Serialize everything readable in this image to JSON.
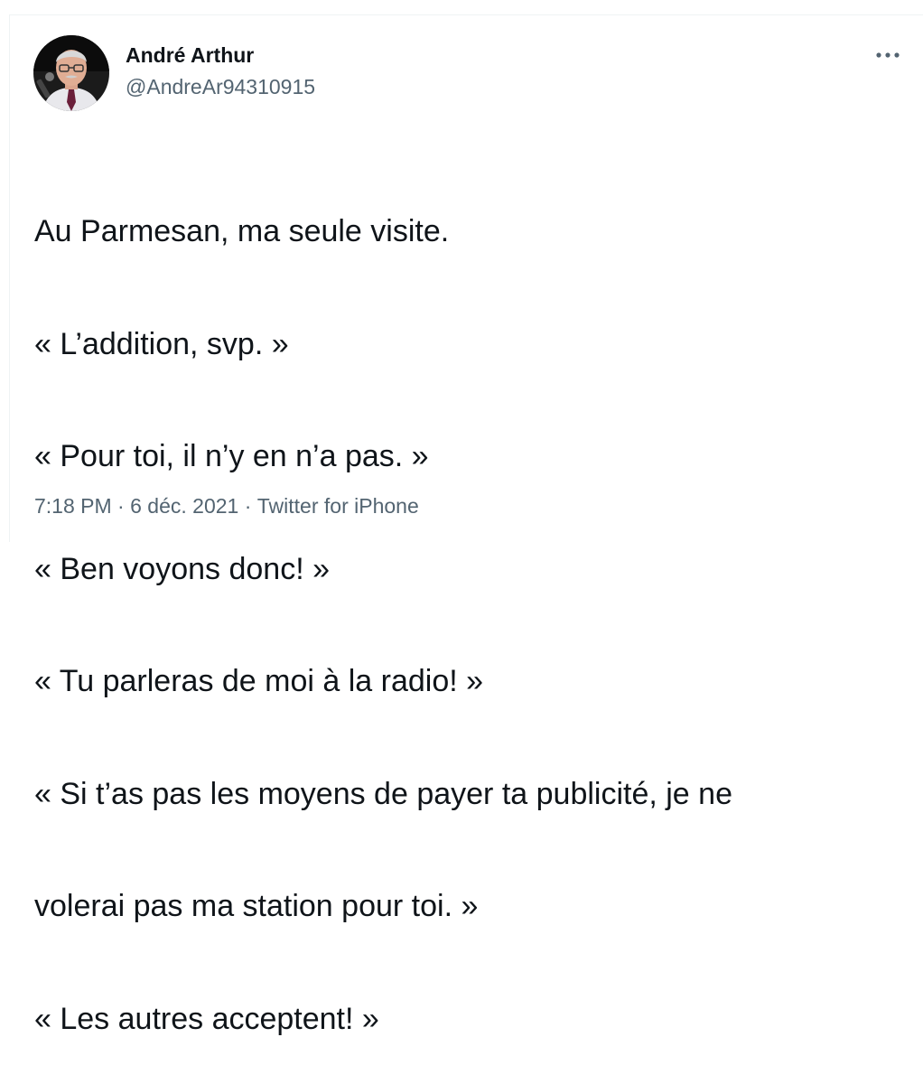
{
  "author": {
    "display_name": "André Arthur",
    "handle": "@AndreAr94310915"
  },
  "tweet": {
    "lines": [
      "Au Parmesan, ma seule visite.",
      "« L’addition, svp. »",
      "« Pour toi, il n’y en n’a pas. »",
      "« Ben voyons donc! »",
      "« Tu parleras de moi à la radio! »",
      "« Si t’as pas les moyens de payer ta publicité, je ne",
      "volerai pas ma station pour toi. »",
      "« Les autres acceptent! »"
    ]
  },
  "meta": {
    "time": "7:18 PM",
    "separator": "·",
    "date": "6 déc. 2021",
    "source": "Twitter for iPhone"
  },
  "icons": {
    "more": "more-horizontal-icon",
    "avatar": "profile-photo"
  },
  "colors": {
    "text": "#0f1419",
    "secondary": "#536471",
    "border": "#eff3f4"
  }
}
